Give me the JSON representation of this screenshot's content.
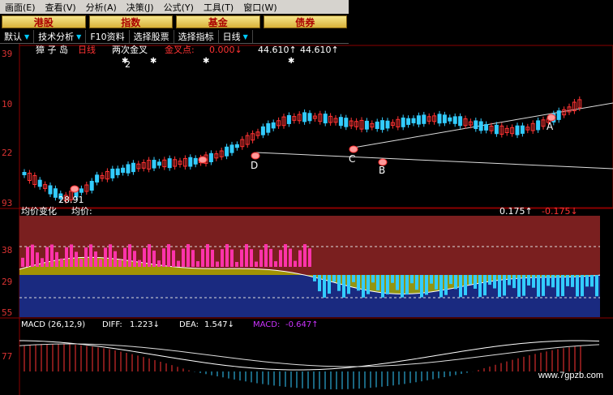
{
  "menu": [
    "画面(E)",
    "查看(V)",
    "分析(A)",
    "决策(J)",
    "公式(Y)",
    "工具(T)",
    "窗口(W)"
  ],
  "market_tabs": [
    "港股",
    "指数",
    "基金",
    "债券"
  ],
  "toolbar": [
    {
      "label": "默认",
      "arrow": true
    },
    {
      "label": "技术分析",
      "arrow": true
    },
    {
      "label": "F10资料",
      "arrow": false
    },
    {
      "label": "选择股票",
      "arrow": false
    },
    {
      "label": "选择指标",
      "arrow": false
    },
    {
      "label": "日线",
      "arrow": true
    }
  ],
  "header": {
    "stock": "獐 子 岛",
    "period": "日线",
    "indicator": "两次金叉",
    "goldcross_label": "金叉点:",
    "goldcross_value": "0.000↓",
    "value2": "44.610↑",
    "value3": "44.610↑"
  },
  "annotations": {
    "marker_label": "2",
    "low_label": "28.91"
  },
  "price_axis": [
    "39",
    "10",
    "22",
    "93"
  ],
  "points": [
    "D",
    "C",
    "B",
    "A"
  ],
  "avg_panel": {
    "title1": "均价变化",
    "title2": "均价:",
    "value1": "0.175↑",
    "value2": "-0.175↓",
    "axis": [
      "38",
      "29",
      "55"
    ]
  },
  "macd": {
    "label": "MACD (26,12,9)",
    "diff_label": "DIFF:",
    "diff_value": "1.223↓",
    "dea_label": "DEA:",
    "dea_value": "1.547↓",
    "macd_label": "MACD:",
    "macd_value": "-0.647↑",
    "axis": [
      "77"
    ]
  },
  "watermark": "www.7gpzb.com",
  "colors": {
    "up": "#ff3333",
    "down": "#33ccff",
    "avg_upper": "#7a1f1f",
    "avg_lower": "#1a2a80",
    "avg_fill": "#a8a800",
    "menu_bg": "#d6d3ce",
    "tab_text": "#aa0000"
  }
}
